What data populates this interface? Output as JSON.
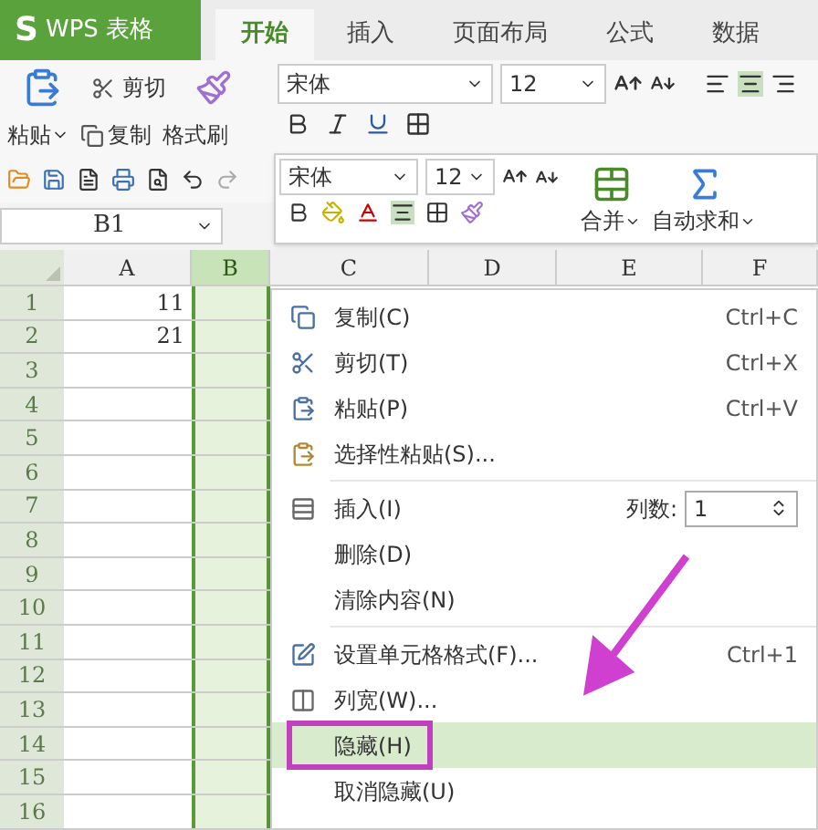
{
  "app": {
    "logo_mark": "S",
    "title": "WPS 表格"
  },
  "tabs": [
    {
      "label": "开始",
      "selected": true
    },
    {
      "label": "插入",
      "selected": false
    },
    {
      "label": "页面布局",
      "selected": false
    },
    {
      "label": "公式",
      "selected": false
    },
    {
      "label": "数据",
      "selected": false
    }
  ],
  "clipboard": {
    "cut": "剪切",
    "paste": "粘贴",
    "copy": "复制",
    "format_painter": "格式刷"
  },
  "font": {
    "name": "宋体",
    "size": "12"
  },
  "mini_toolbar": {
    "font": "宋体",
    "size": "12",
    "merge": "合并",
    "autosum": "自动求和"
  },
  "name_box": "B1",
  "columns": [
    {
      "label": "A",
      "selected": false
    },
    {
      "label": "B",
      "selected": true
    },
    {
      "label": "C",
      "selected": false
    },
    {
      "label": "D",
      "selected": false
    },
    {
      "label": "E",
      "selected": false
    },
    {
      "label": "F",
      "selected": false
    }
  ],
  "rows": [
    {
      "label": "1",
      "cells": [
        "11",
        ""
      ]
    },
    {
      "label": "2",
      "cells": [
        "21",
        ""
      ]
    },
    {
      "label": "3",
      "cells": [
        "",
        ""
      ]
    },
    {
      "label": "4",
      "cells": [
        "",
        ""
      ]
    },
    {
      "label": "5",
      "cells": [
        "",
        ""
      ]
    },
    {
      "label": "6",
      "cells": [
        "",
        ""
      ]
    },
    {
      "label": "7",
      "cells": [
        "",
        ""
      ]
    },
    {
      "label": "8",
      "cells": [
        "",
        ""
      ]
    },
    {
      "label": "9",
      "cells": [
        "",
        ""
      ]
    },
    {
      "label": "10",
      "cells": [
        "",
        ""
      ]
    },
    {
      "label": "11",
      "cells": [
        "",
        ""
      ]
    },
    {
      "label": "12",
      "cells": [
        "",
        ""
      ]
    },
    {
      "label": "13",
      "cells": [
        "",
        ""
      ]
    },
    {
      "label": "14",
      "cells": [
        "",
        ""
      ]
    },
    {
      "label": "15",
      "cells": [
        "",
        ""
      ]
    },
    {
      "label": "16",
      "cells": [
        "",
        ""
      ]
    }
  ],
  "context_menu": [
    {
      "kind": "item",
      "label": "复制(C)",
      "shortcut": "Ctrl+C",
      "selected": false,
      "circled": false
    },
    {
      "kind": "item",
      "label": "剪切(T)",
      "shortcut": "Ctrl+X",
      "selected": false,
      "circled": false
    },
    {
      "kind": "item",
      "label": "粘贴(P)",
      "shortcut": "Ctrl+V",
      "selected": false,
      "circled": false
    },
    {
      "kind": "item",
      "label": "选择性粘贴(S)...",
      "selected": false,
      "circled": false
    },
    {
      "kind": "separator"
    },
    {
      "kind": "spin",
      "label": "插入(I)",
      "field_label": "列数:",
      "value": "1",
      "selected": false,
      "circled": false
    },
    {
      "kind": "item",
      "label": "删除(D)",
      "selected": false,
      "circled": false
    },
    {
      "kind": "item",
      "label": "清除内容(N)",
      "selected": false,
      "circled": false
    },
    {
      "kind": "separator"
    },
    {
      "kind": "item",
      "label": "设置单元格格式(F)...",
      "shortcut": "Ctrl+1",
      "selected": false,
      "circled": false
    },
    {
      "kind": "item",
      "label": "列宽(W)...",
      "selected": false,
      "circled": false
    },
    {
      "kind": "item",
      "label": "隐藏(H)",
      "selected": true,
      "circled": true
    },
    {
      "kind": "item",
      "label": "取消隐藏(U)",
      "selected": false,
      "circled": false
    }
  ]
}
